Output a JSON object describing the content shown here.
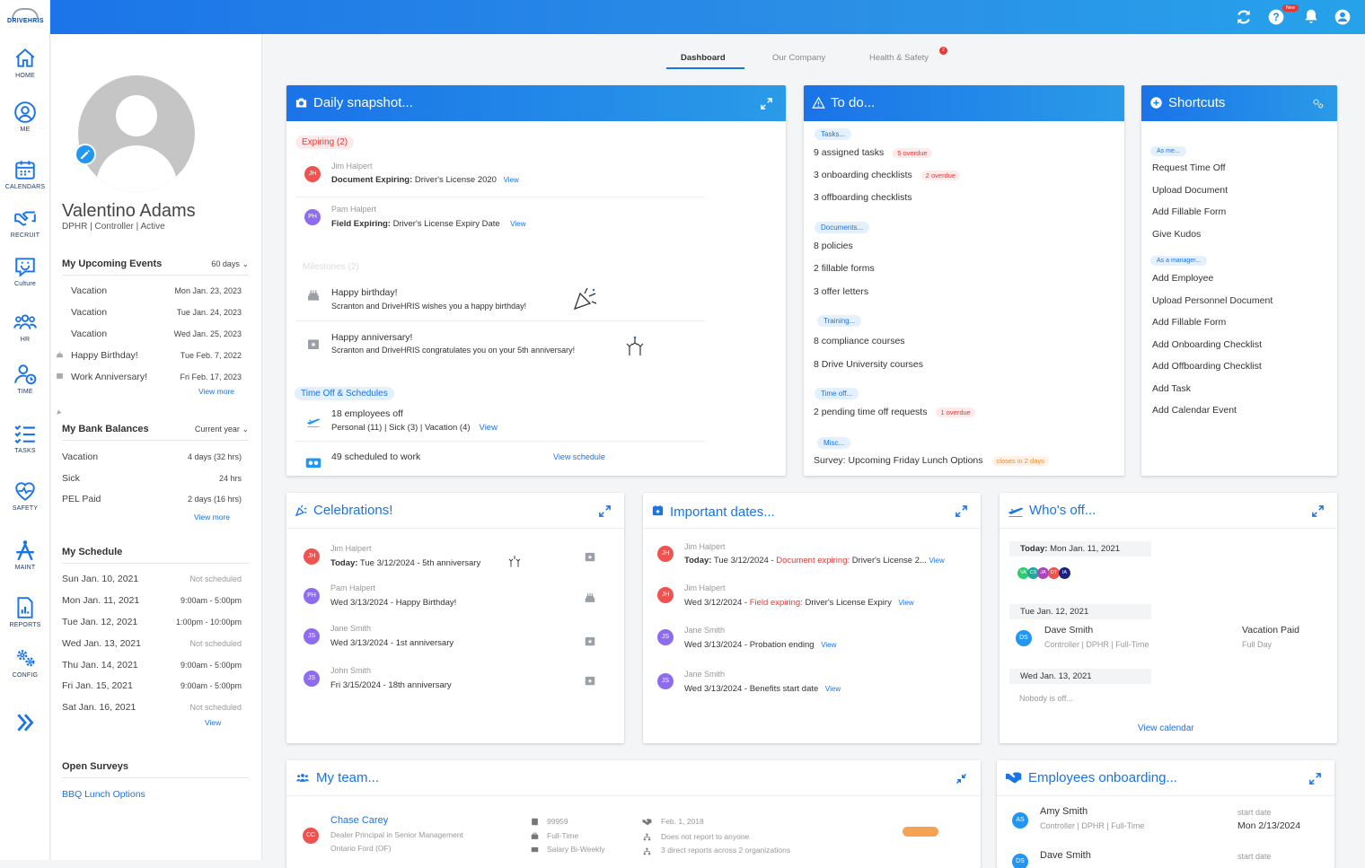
{
  "topbar": {
    "logo": "DRIVEHRIS",
    "new_badge": "New"
  },
  "nav": [
    {
      "label": "HOME",
      "icon": "home-icon"
    },
    {
      "label": "ME",
      "icon": "user-circle-icon"
    },
    {
      "label": "CALENDARS",
      "icon": "calendar-icon"
    },
    {
      "label": "RECRUIT",
      "icon": "handshake-icon"
    },
    {
      "label": "Culture",
      "icon": "chat-smile-icon"
    },
    {
      "label": "HR",
      "icon": "people-icon"
    },
    {
      "label": "TIME",
      "icon": "user-clock-icon"
    },
    {
      "label": "TASKS",
      "icon": "checklist-icon"
    },
    {
      "label": "SAFETY",
      "icon": "heart-pulse-icon"
    },
    {
      "label": "MAINT",
      "icon": "compass-tool-icon"
    },
    {
      "label": "REPORTS",
      "icon": "report-icon"
    },
    {
      "label": "CONFIG",
      "icon": "gears-icon"
    }
  ],
  "profile": {
    "name": "Valentino Adams",
    "sub": "DPHR  |  Controller  |  Active",
    "events": {
      "title": "My Upcoming Events",
      "range": "60 days",
      "items": [
        {
          "label": "Vacation",
          "date": "Mon Jan. 23, 2023"
        },
        {
          "label": "Vacation",
          "date": "Tue Jan. 24, 2023"
        },
        {
          "label": "Vacation",
          "date": "Wed Jan. 25, 2023"
        },
        {
          "label": "Happy Birthday!",
          "date": "Tue Feb. 7, 2022"
        },
        {
          "label": "Work Anniversary!",
          "date": "Fri Feb. 17, 2023"
        }
      ],
      "more": "View more"
    },
    "bank": {
      "title": "My Bank Balances",
      "range": "Current year",
      "items": [
        {
          "label": "Vacation",
          "value": "4 days (32 hrs)"
        },
        {
          "label": "Sick",
          "value": "24 hrs"
        },
        {
          "label": "PEL Paid",
          "value": "2 days (16 hrs)"
        }
      ],
      "more": "View more"
    },
    "schedule": {
      "title": "My Schedule",
      "items": [
        {
          "day": "Sun Jan. 10, 2021",
          "time": "Not scheduled"
        },
        {
          "day": "Mon Jan. 11, 2021",
          "time": "9:00am - 5:00pm"
        },
        {
          "day": "Tue Jan. 12, 2021",
          "time": "1:00pm - 10:00pm"
        },
        {
          "day": "Wed Jan. 13, 2021",
          "time": "Not scheduled"
        },
        {
          "day": "Thu Jan. 14, 2021",
          "time": "9:00am - 5:00pm"
        },
        {
          "day": "Fri Jan. 15, 2021",
          "time": "9:00am - 5:00pm"
        },
        {
          "day": "Sat Jan. 16, 2021",
          "time": "Not scheduled"
        }
      ],
      "more": "View"
    },
    "surveys": {
      "title": "Open Surveys",
      "item": "BBQ Lunch Options"
    }
  },
  "tabs": {
    "dashboard": "Dashboard",
    "company": "Our Company",
    "safety": "Health  & Safety",
    "safety_count": "2"
  },
  "snapshot": {
    "title": "Daily snapshot...",
    "expiring_label": "Expiring (2)",
    "expiring": [
      {
        "initials": "JH",
        "name": "Jim Halpert",
        "kind": "Document Expiring:",
        "detail": "Driver's License 2020",
        "link": "View"
      },
      {
        "initials": "PH",
        "name": "Pam Halpert",
        "kind": "Field Expiring:",
        "detail": "Driver's License Expiry Date",
        "link": "View"
      }
    ],
    "milestones_label": "Milestones (2)",
    "milestones": [
      {
        "title": "Happy birthday!",
        "text": "Scranton and DriveHRIS wishes you a happy birthday!"
      },
      {
        "title": "Happy anniversary!",
        "text": "Scranton and DriveHRIS congratulates you on your 5th anniversary!"
      }
    ],
    "timeoff_label": "Time Off & Schedules",
    "employees_off": "18 employees off",
    "breakdown": "Personal (11)  |  Sick (3)  |  Vacation (4)",
    "breakdown_link": "View",
    "scheduled": "49 scheduled to work",
    "schedule_link": "View schedule"
  },
  "todo": {
    "title": "To do...",
    "groups": [
      {
        "label": "Tasks...",
        "items": [
          {
            "text": "9 assigned tasks",
            "badge": "5 overdue",
            "badge_color": "red"
          },
          {
            "text": "3 onboarding checklists",
            "badge": "2 overdue",
            "badge_color": "red"
          },
          {
            "text": "3 offboarding checklists",
            "badge": "",
            "badge_color": ""
          }
        ]
      },
      {
        "label": "Documents...",
        "items": [
          {
            "text": "8 policies",
            "badge": "",
            "badge_color": ""
          },
          {
            "text": "2 fillable forms",
            "badge": "",
            "badge_color": ""
          },
          {
            "text": "3 offer letters",
            "badge": "",
            "badge_color": ""
          }
        ]
      },
      {
        "label": "Training...",
        "items": [
          {
            "text": "8 compliance courses",
            "badge": "",
            "badge_color": ""
          },
          {
            "text": "8 Drive University courses",
            "badge": "",
            "badge_color": ""
          }
        ]
      },
      {
        "label": "Time off...",
        "items": [
          {
            "text": "2 pending time off requests",
            "badge": "1 overdue",
            "badge_color": "red"
          }
        ]
      },
      {
        "label": "Misc...",
        "items": [
          {
            "text": "Survey: Upcoming Friday Lunch Options",
            "badge": "closes in 2 days",
            "badge_color": "orange"
          }
        ]
      }
    ]
  },
  "shortcuts": {
    "title": "Shortcuts",
    "me_label": "As me...",
    "me_items": [
      "Request Time Off",
      "Upload Document",
      "Add Fillable Form",
      "Give Kudos"
    ],
    "mgr_label": "As a manager...",
    "mgr_items": [
      "Add Employee",
      "Upload Personnel Document",
      "Add Fillable Form",
      "Add Onboarding Checklist",
      "Add Offboarding Checklist",
      "Add Task",
      "Add Calendar Event"
    ]
  },
  "celebrations": {
    "title": "Celebrations!",
    "items": [
      {
        "initials": "JH",
        "color": "red",
        "name": "Jim Halpert",
        "prefix": "Today:",
        "text": "Tue 3/12/2024 - 5th anniversary"
      },
      {
        "initials": "PH",
        "color": "purple",
        "name": "Pam Halpert",
        "prefix": "",
        "text": "Wed 3/13/2024 - Happy Birthday!"
      },
      {
        "initials": "JS",
        "color": "purple",
        "name": "Jane Smith",
        "prefix": "",
        "text": "Wed 3/13/2024 - 1st anniversary"
      },
      {
        "initials": "JS",
        "color": "purple",
        "name": "John Smith",
        "prefix": "",
        "text": "Fri 3/15/2024 - 18th anniversary"
      }
    ]
  },
  "important": {
    "title": "Important dates...",
    "items": [
      {
        "initials": "JH",
        "color": "red",
        "name": "Jim Halpert",
        "prefix": "Today:",
        "date": "Tue 3/12/2024 -",
        "highlight": "Document expiring:",
        "text": "Driver's License 2...",
        "link": "View"
      },
      {
        "initials": "JH",
        "color": "red",
        "name": "Jim Halpert",
        "prefix": "",
        "date": "Wed 3/12/2024 -",
        "highlight": "Field expiring:",
        "text": "Driver's License Expiry",
        "link": "View"
      },
      {
        "initials": "JS",
        "color": "purple",
        "name": "Jane Smith",
        "prefix": "",
        "date": "Wed 3/13/2024 - Probation ending",
        "highlight": "",
        "text": "",
        "link": "View"
      },
      {
        "initials": "JS",
        "color": "purple",
        "name": "Jane Smith",
        "prefix": "",
        "date": "Wed 3/13/2024 - Benefits start date",
        "highlight": "",
        "text": "",
        "link": "View"
      }
    ]
  },
  "whosoff": {
    "title": "Who's off...",
    "today_label": "Today:",
    "today_date": "Mon Jan. 11, 2021",
    "today_avatars": [
      {
        "initials": "VA",
        "color": "#2ecc71"
      },
      {
        "initials": "CS",
        "color": "#26a69a"
      },
      {
        "initials": "JA",
        "color": "#ab47bc"
      },
      {
        "initials": "DT",
        "color": "#ef5350"
      },
      {
        "initials": "IA",
        "color": "#1a237e"
      }
    ],
    "day2": "Tue Jan. 12, 2021",
    "person": {
      "initials": "DS",
      "name": "Dave Smith",
      "meta": "Controller  |  DPHR  |  Full-Time",
      "type": "Vacation Paid",
      "duration": "Full Day"
    },
    "day3": "Wed Jan. 13, 2021",
    "nobody": "Nobody is off...",
    "link": "View calendar"
  },
  "team": {
    "title": "My team...",
    "member": {
      "initials": "CC",
      "name": "Chase Carey",
      "role": "Dealer Principal in Senior Management",
      "location": "Ontario Ford (OF)",
      "id": "99959",
      "type": "Full-Time",
      "pay": "Salary Bi-Weekly",
      "hired": "Feb. 1, 2018",
      "reports_to": "Does not report to anyone",
      "direct": "3 direct reports across 2 organizations"
    }
  },
  "onboarding": {
    "title": "Employees onboarding...",
    "items": [
      {
        "initials": "AS",
        "name": "Amy Smith",
        "meta": "Controller  |  DPHR  |  Full-Time",
        "start_label": "start date",
        "start": "Mon 2/13/2024"
      },
      {
        "initials": "DS",
        "name": "Dave Smith",
        "meta": "",
        "start_label": "start date",
        "start": ""
      }
    ]
  },
  "colors": {
    "primary": "#1a73e8",
    "danger": "#e53935",
    "warning": "#f08a24"
  }
}
